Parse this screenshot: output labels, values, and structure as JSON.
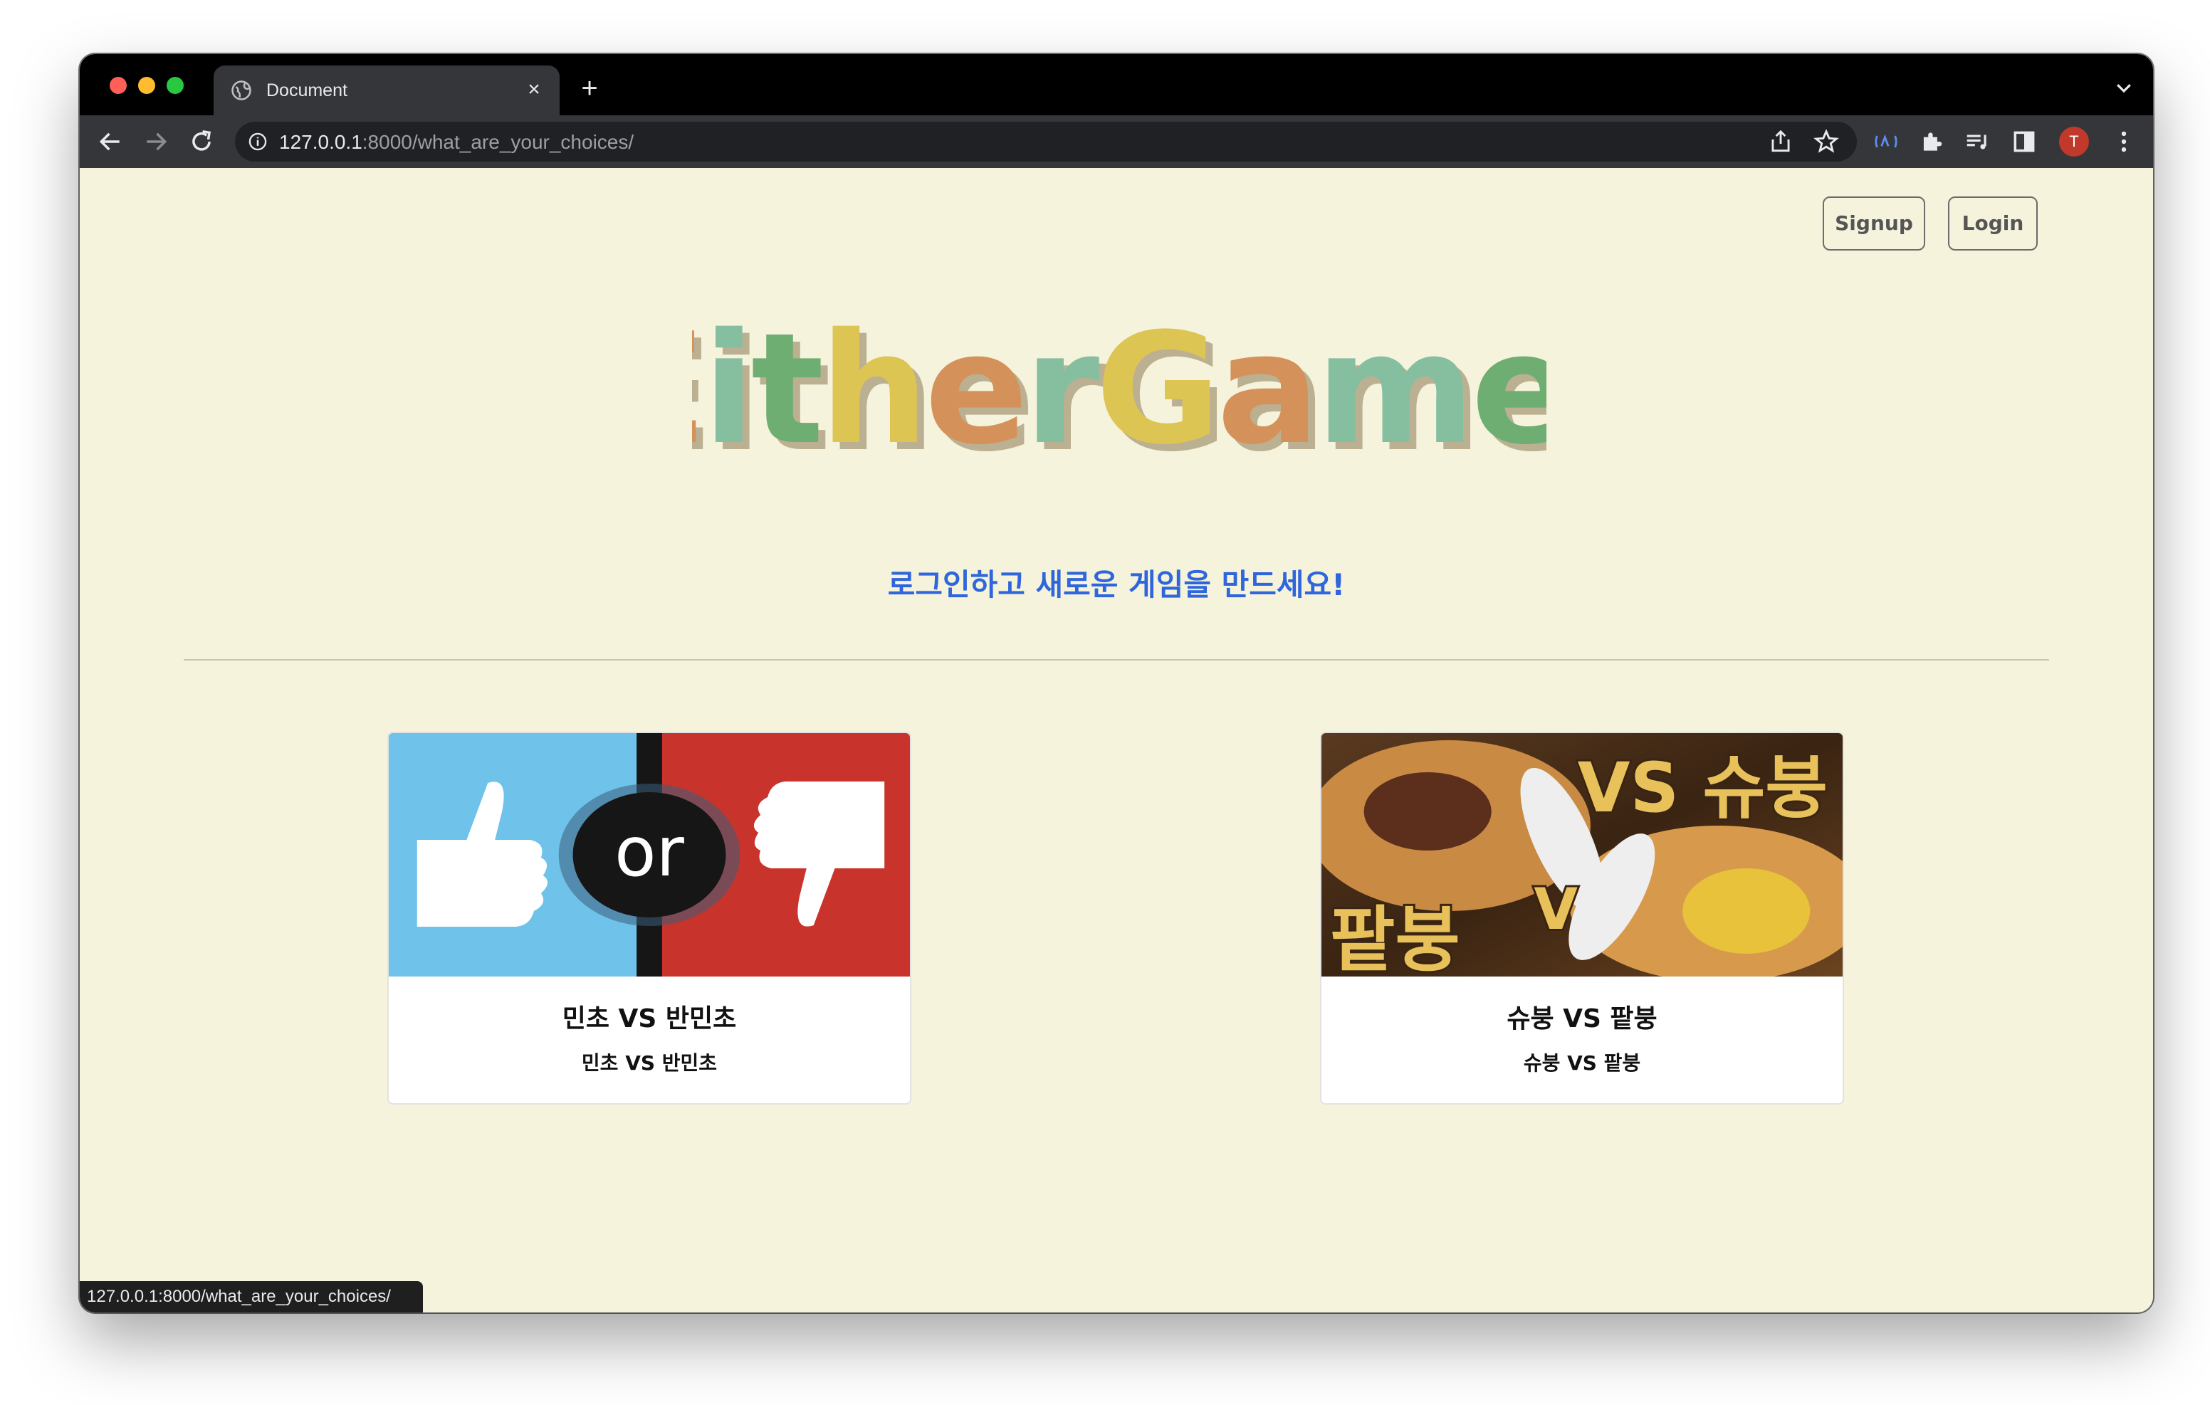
{
  "browser": {
    "tab_title": "Document",
    "tab_close": "×",
    "new_tab": "+",
    "url_host": "127.0.0.1",
    "url_path": ":8000/what_are_your_choices/",
    "profile_initial": "T",
    "status_url": "127.0.0.1:8000/what_are_your_choices/"
  },
  "header": {
    "signup_label": "Signup",
    "login_label": "Login"
  },
  "logo": {
    "text": "EitherGame!",
    "letters": [
      {
        "ch": "E",
        "color": "#d4925a"
      },
      {
        "ch": "i",
        "color": "#85bf9f"
      },
      {
        "ch": "t",
        "color": "#6fae72"
      },
      {
        "ch": "h",
        "color": "#dcc553"
      },
      {
        "ch": "e",
        "color": "#d4925a"
      },
      {
        "ch": "r",
        "color": "#85bf9f"
      },
      {
        "ch": "G",
        "color": "#dcc553"
      },
      {
        "ch": "a",
        "color": "#d4925a"
      },
      {
        "ch": "m",
        "color": "#85bf9f"
      },
      {
        "ch": "e",
        "color": "#6fae72"
      },
      {
        "ch": "!",
        "color": "#dcc553"
      }
    ]
  },
  "subtitle": "로그인하고 새로운 게임을 만드세요!",
  "cards": [
    {
      "title": "민초 VS 반민초",
      "text": "민초 VS 반민초",
      "image_label": "or"
    },
    {
      "title": "슈붕 VS 팥붕",
      "text": "슈붕 VS 팥붕",
      "image_label_top": "VS 슈붕",
      "image_label_bottom": "팥붕"
    }
  ],
  "colors": {
    "page_bg": "#f5f3dc",
    "subtitle": "#2f66dc",
    "accent_blue": "#6fc2ea",
    "accent_red": "#c8342c"
  }
}
